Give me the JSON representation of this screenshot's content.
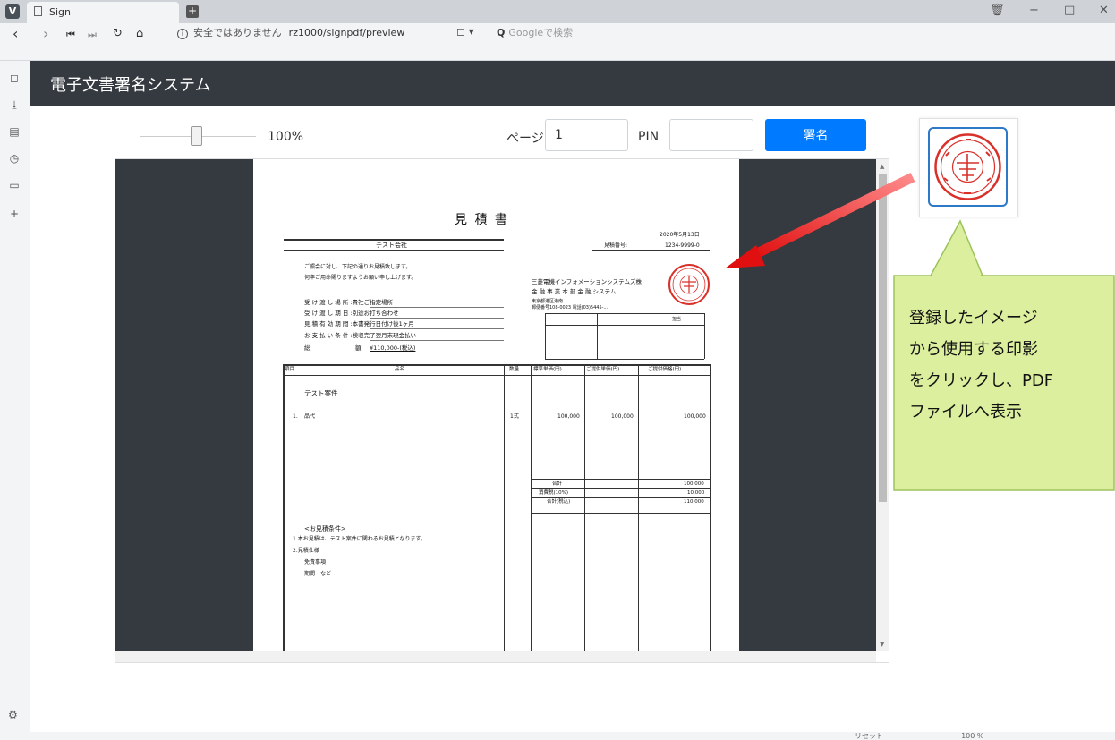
{
  "browser": {
    "tab_title": "Sign",
    "security_warning": "安全ではありません",
    "url": "rz1000/signpdf/preview",
    "search_placeholder": "Googleで検索",
    "status_reset": "リセット",
    "status_zoom": "100 %"
  },
  "app": {
    "title": "電子文書署名システム",
    "zoom_value": "100%",
    "zoom_slider_percent": 45,
    "page_label": "ページ",
    "page_value": "1",
    "pin_label": "PIN",
    "pin_value": "",
    "sign_button": "署名"
  },
  "pdf": {
    "doc_title": "見 積 書",
    "date": "2020年5月13日",
    "company": "テスト会社",
    "estimate_no_label": "見積番号:",
    "estimate_no": "1234-9999-0",
    "greeting1": "ご照会に対し、下記の通りお見積致します。",
    "greeting2": "何卒ご用命賜りますようお願い申し上げます。",
    "cond1": "受 け 渡 し 場 所 :貴社ご指定場所",
    "cond2": "受 け 渡 し 期 日 :別途お打ち合わせ",
    "cond3": "見 積 有 効 期 間 :本書発行日付け後1ヶ月",
    "cond4": "お 支 払 い 条 件 :検収完了翌月末現金払い",
    "total_label": "総",
    "total_label2": "額",
    "total_value": "¥110,000-(税込)",
    "issuer1": "三菱電機インフォメーションシステムズ株",
    "issuer2": "金 融 事 業 本 部 金 融 システム",
    "issuer3": "東京都港区港南 ...",
    "issuer4": "郵便番号108-0023 電話(03)5445-...",
    "approval_label": "担当",
    "col_item": "項目",
    "col_name": "品名",
    "col_qty": "数量",
    "col_std": "標準単価(円)",
    "col_offer": "ご提供単価(円)",
    "col_price": "ご提供価格(円)",
    "project": "テスト案件",
    "row_no": "1.",
    "row_name": "品代",
    "row_qty": "1式",
    "row_std": "100,000",
    "row_offer": "100,000",
    "row_price": "100,000",
    "subtotal_label": "合計",
    "subtotal": "100,000",
    "tax_label": "消費税(10%)",
    "tax": "10,000",
    "total_incl_label": "合計(税込)",
    "total_incl": "110,000",
    "notes_title": "<お見積条件>",
    "note1": "1.本お見積は、テスト案件に関わるお見積となります。",
    "note2": "2.見積仕様",
    "note3": "免責事項",
    "note4": "期間　など"
  },
  "stamp_picker": {
    "selected_stamp": "seal-stamp"
  },
  "callout": {
    "line1": "登録したイメージ",
    "line2": "から使用する印影",
    "line3": "をクリックし、PDF",
    "line4": "ファイルへ表示"
  },
  "colors": {
    "header_bg": "#343a40",
    "primary_button": "#007bff",
    "callout_bg": "#dcef9e",
    "arrow": "#e01010",
    "seal": "#d9302a"
  }
}
